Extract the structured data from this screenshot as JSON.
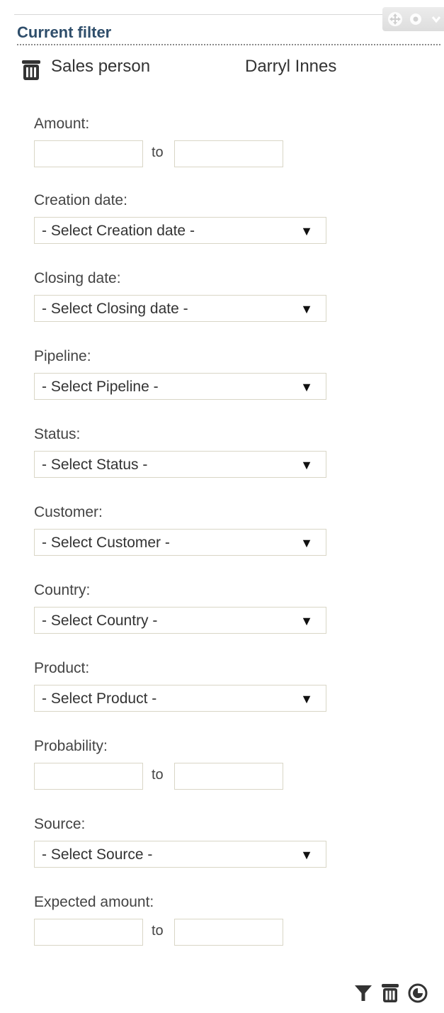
{
  "filter": {
    "title": "Current filter",
    "current": {
      "key": "Sales person",
      "value": "Darryl Innes"
    }
  },
  "fields": [
    {
      "id": "amount",
      "label": "Amount:",
      "kind": "range",
      "to_label": "to",
      "from_value": "",
      "to_value": ""
    },
    {
      "id": "creation-date",
      "label": "Creation date:",
      "kind": "select",
      "selected": "- Select Creation date -"
    },
    {
      "id": "closing-date",
      "label": "Closing date:",
      "kind": "select",
      "selected": "- Select Closing date -"
    },
    {
      "id": "pipeline",
      "label": "Pipeline:",
      "kind": "select",
      "selected": "- Select Pipeline -"
    },
    {
      "id": "status",
      "label": "Status:",
      "kind": "select",
      "selected": "- Select Status -"
    },
    {
      "id": "customer",
      "label": "Customer:",
      "kind": "select",
      "selected": "- Select Customer -"
    },
    {
      "id": "country",
      "label": "Country:",
      "kind": "select",
      "selected": "- Select Country -"
    },
    {
      "id": "product",
      "label": "Product:",
      "kind": "select",
      "selected": "- Select Product -"
    },
    {
      "id": "probability",
      "label": "Probability:",
      "kind": "range",
      "to_label": "to",
      "from_value": "",
      "to_value": ""
    },
    {
      "id": "source",
      "label": "Source:",
      "kind": "select",
      "selected": "- Select Source -"
    },
    {
      "id": "expected-amount",
      "label": "Expected amount:",
      "kind": "range",
      "to_label": "to",
      "from_value": "",
      "to_value": ""
    }
  ],
  "select_arrow": "▼",
  "icons": {
    "remove": "trash-icon",
    "apply": "filter-icon",
    "clear": "trash-icon",
    "reset": "reset-icon",
    "move": "move-icon",
    "settings": "gear-icon"
  },
  "colors": {
    "title": "#2f4e6b",
    "field_border": "#d9d6c6"
  }
}
